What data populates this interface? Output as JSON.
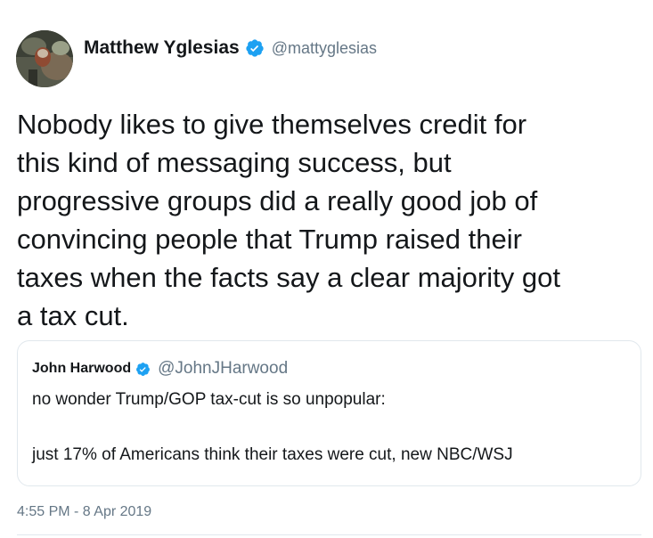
{
  "author": {
    "display_name": "Matthew Yglesias",
    "handle": "@mattyglesias",
    "verified_icon": "verified-badge-icon",
    "avatar": "avatar-photo"
  },
  "tweet": {
    "text": "Nobody likes to give themselves credit for\nthis kind of messaging success, but\nprogressive groups did a really good job of\nconvincing people that Trump raised their\ntaxes when the facts say a clear majority got\na tax cut.",
    "timestamp": "4:55 PM - 8 Apr 2019"
  },
  "quoted_tweet": {
    "display_name": "John Harwood",
    "handle": "@JohnJHarwood",
    "verified_icon": "verified-badge-icon",
    "line1": "no wonder Trump/GOP tax-cut is so unpopular:",
    "line2": "just 17% of Americans think their taxes were cut, new NBC/WSJ"
  },
  "colors": {
    "verified_blue": "#1da1f2",
    "secondary_text": "#657786",
    "primary_text": "#14171a",
    "border": "#e1e8ed"
  }
}
